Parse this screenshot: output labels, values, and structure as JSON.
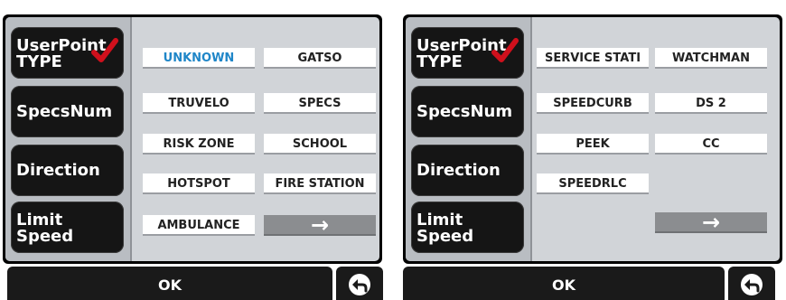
{
  "left_screen": {
    "side_buttons": [
      {
        "line1": "UserPoint",
        "line2": "TYPE"
      },
      {
        "label": "SpecsNum"
      },
      {
        "label": "Direction"
      },
      {
        "line1": "Limit",
        "line2": "Speed"
      }
    ],
    "options": [
      "UNKNOWN",
      "GATSO",
      "TRUVELO",
      "SPECS",
      "RISK ZONE",
      "SCHOOL",
      "HOTSPOT",
      "FIRE STATION",
      "AMBULANCE"
    ],
    "selected_option": "UNKNOWN",
    "next_arrow": "→",
    "ok_label": "OK"
  },
  "right_screen": {
    "side_buttons": [
      {
        "line1": "UserPoint",
        "line2": "TYPE"
      },
      {
        "label": "SpecsNum"
      },
      {
        "label": "Direction"
      },
      {
        "line1": "Limit",
        "line2": "Speed"
      }
    ],
    "options": [
      "SERVICE STATI",
      "WATCHMAN",
      "SPEEDCURB",
      "DS 2",
      "PEEK",
      "CC",
      "SPEEDRLC"
    ],
    "next_arrow": "→",
    "ok_label": "OK"
  },
  "icons": {
    "check": "checkmark-icon",
    "back": "back-arrow-icon"
  },
  "colors": {
    "selected_text": "#1f86c8",
    "check": "#d0101c"
  }
}
